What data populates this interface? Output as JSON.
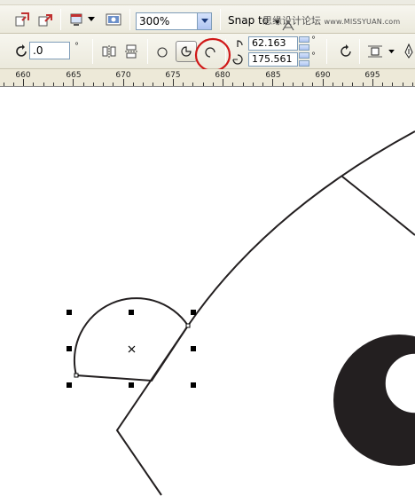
{
  "toolbar": {
    "zoom_value": "300%",
    "snap_label": "Snap to",
    "watermark_cn": "思缘设计论坛",
    "watermark_url": "www.MISSYUAN.com"
  },
  "property_bar": {
    "rotation_value": ".0",
    "start_angle": "62.163",
    "end_angle": "175.561",
    "degree_symbol": "°"
  },
  "ruler": {
    "labels": [
      "660",
      "665",
      "670",
      "675",
      "680",
      "685",
      "690",
      "695"
    ]
  },
  "colors": {
    "annotation_circle": "#d01818",
    "shape_fill": "#231f20",
    "toolbar_bg": "#ebe9dc"
  }
}
